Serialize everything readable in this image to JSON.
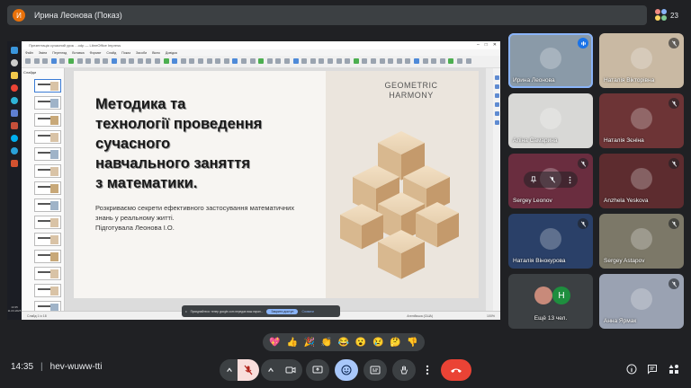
{
  "meet": {
    "presenter": {
      "initial": "И",
      "name": "Ирина Леонова (Показ)",
      "avatar_color": "#e8710a"
    },
    "participant_count": "23",
    "time": "14:35",
    "meeting_code": "hev-wuww-tti",
    "separator": "|"
  },
  "office": {
    "title": "Презентація сучасний урок ...odp — LibreOffice Impress",
    "menu": [
      "Файл",
      "Зміни",
      "Перегляд",
      "Вставка",
      "Формат",
      "Слайд",
      "Показ",
      "Засоби",
      "Вікно",
      "Довідка"
    ],
    "slides_label": "Слайди",
    "status_left": "Слайд 1 із 18",
    "status_mid": "Англійська (США)",
    "status_right": "100%",
    "tb_clock": "14:35\n11.03.2025"
  },
  "slide": {
    "title": "Методика та\nтехнології проведення\n сучасного\nнавчального заняття\nз математики.",
    "subtitle": "Розкриваємо секрети ефективного застосування математичних\nзнань у реальному житті.\nПідготувала Леонова І.О.",
    "geo_label": "GEOMETRIC\nHARMONY"
  },
  "share_banner": {
    "text": "Приєднайтеся: тепер google.com передає ваш екран...",
    "share_label": "Закрити доступ",
    "hide_label": "Сховати"
  },
  "participants": [
    {
      "name": "Ирина Леонова",
      "bg": "#8a9aa8",
      "active": true,
      "muted": false
    },
    {
      "name": "Наталія Вікторівна",
      "bg": "#c9b9a3",
      "muted": true
    },
    {
      "name": "Аліна Самарина",
      "bg": "#d8d8d6",
      "muted": false
    },
    {
      "name": "Наталія Зєніна",
      "bg": "#6d3436",
      "muted": true
    },
    {
      "name": "Sergey Leonov",
      "bg": "#6a2d3f",
      "muted": true
    },
    {
      "name": "Anzhela Yeskova",
      "bg": "#5d2c2f",
      "muted": true
    },
    {
      "name": "Наталія Вінокурова",
      "bg": "#2a4068",
      "muted": true
    },
    {
      "name": "Sergey Astapov",
      "bg": "#7c7868",
      "muted": true
    },
    {
      "name": "Ещё 13 чел.",
      "bg": "#3c4043",
      "muted": false
    },
    {
      "name": "Анна Ярмак",
      "bg": "#9aa2b2",
      "muted": true
    }
  ],
  "more_avatar_letter": "H",
  "reactions": [
    "💖",
    "👍",
    "🎉",
    "👏",
    "😂",
    "😮",
    "😢",
    "🤔",
    "👎"
  ],
  "colors": {
    "end_call": "#ea4335",
    "accent": "#8ab4f8",
    "mic_off": "#f9dedc"
  }
}
